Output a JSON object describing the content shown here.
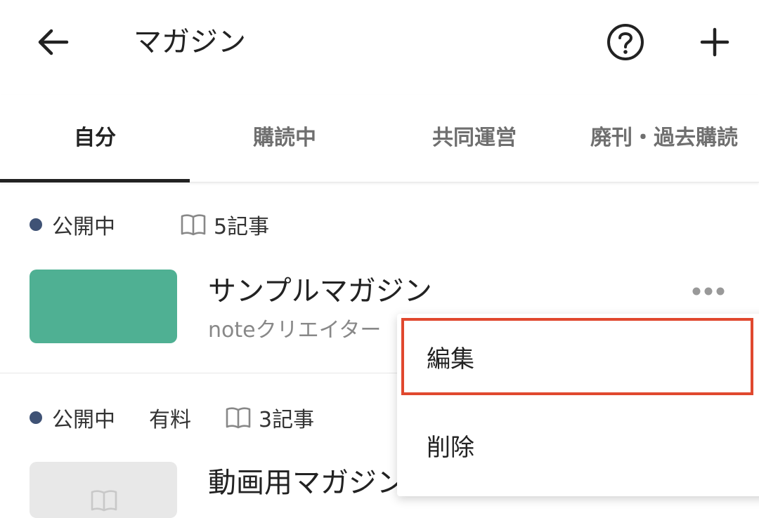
{
  "header": {
    "title": "マガジン",
    "back_icon": "arrow-left-icon",
    "help_icon": "help-circle-icon",
    "add_icon": "plus-icon"
  },
  "tabs": [
    {
      "label": "自分",
      "active": true
    },
    {
      "label": "購読中",
      "active": false
    },
    {
      "label": "共同運営",
      "active": false
    },
    {
      "label": "廃刊・過去購読",
      "active": false
    }
  ],
  "magazines": [
    {
      "status": "公開中",
      "paid_label": "",
      "article_count": "5記事",
      "title": "サンプルマガジン",
      "author": "noteクリエイター",
      "thumb_color": "#4fb093"
    },
    {
      "status": "公開中",
      "paid_label": "有料",
      "article_count": "3記事",
      "title": "動画用マガジン",
      "author": "",
      "thumb_color": "#e8e8e8"
    }
  ],
  "menu": {
    "edit": "編集",
    "delete": "削除",
    "highlight_color": "#e0482e"
  },
  "colors": {
    "status_dot": "#3f5275",
    "accent_tab": "#222222"
  }
}
